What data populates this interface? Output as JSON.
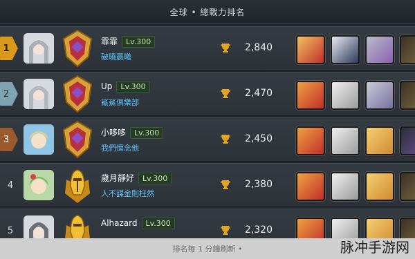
{
  "header": {
    "title": "全球 • 總戰力排名"
  },
  "rows": [
    {
      "rank": "1",
      "name": "霏霏",
      "level": "Lv.300",
      "guild": "破曉晨曦",
      "power": "2,840"
    },
    {
      "rank": "2",
      "name": "Up",
      "level": "Lv.300",
      "guild": "鯊鯊俱樂部",
      "power": "2,470"
    },
    {
      "rank": "3",
      "name": "小哆哆",
      "level": "Lv.300",
      "guild": "我們懷念他",
      "power": "2,450"
    },
    {
      "rank": "4",
      "name": "歲月靜好",
      "level": "Lv.300",
      "guild": "人不謀金則枉然",
      "power": "2,380"
    },
    {
      "rank": "5",
      "name": "Alhazard",
      "level": "Lv.300",
      "guild": "",
      "power": "2,320"
    }
  ],
  "footer": {
    "text": "排名每 1 分鐘刷新 •"
  },
  "watermark": "脉冲手游网",
  "colors": {
    "gold": "#d99a1c",
    "silver": "#7fa3b0",
    "bronze": "#9a5a2e",
    "guild": "#5ec6ff",
    "level": "#c9e6b0"
  }
}
